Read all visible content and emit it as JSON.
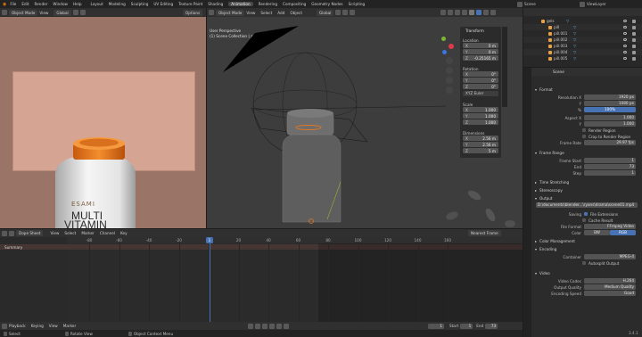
{
  "topbar": {
    "menus": [
      "File",
      "Edit",
      "Render",
      "Window",
      "Help"
    ],
    "tabs": [
      "Layout",
      "Modeling",
      "Sculpting",
      "UV Editing",
      "Texture Paint",
      "Shading",
      "Animation",
      "Rendering",
      "Compositing",
      "Geometry Nodes",
      "Scripting"
    ],
    "active_tab": "Animation",
    "scene_label": "Scene",
    "viewlayer_label": "ViewLayer"
  },
  "camera_view": {
    "mode": "Object Mode",
    "view_label": "View",
    "layer_label": "Global",
    "options_label": "Options",
    "product": {
      "brand": "ESAMI",
      "line1": "MULTI",
      "line2": "VITAMIN"
    }
  },
  "viewport": {
    "mode": "Object Mode",
    "menus": [
      "View",
      "Select",
      "Add",
      "Object"
    ],
    "transform_orientation": "Global",
    "options_label": "Options",
    "overlay_line1": "User Perspective",
    "overlay_line2": "(1) Scene Collection | ambar"
  },
  "n_panel": {
    "title": "Transform",
    "location_label": "Location",
    "location": [
      {
        "axis": "X",
        "value": "0 m"
      },
      {
        "axis": "Y",
        "value": "0 m"
      },
      {
        "axis": "Z",
        "value": "-0.25165 m"
      }
    ],
    "rotation_label": "Rotation",
    "rotation": [
      {
        "axis": "X",
        "value": "0°"
      },
      {
        "axis": "Y",
        "value": "0°"
      },
      {
        "axis": "Z",
        "value": "0°"
      }
    ],
    "rotation_mode": "XYZ Euler",
    "scale_label": "Scale",
    "scale": [
      {
        "axis": "X",
        "value": "1.000"
      },
      {
        "axis": "Y",
        "value": "1.000"
      },
      {
        "axis": "Z",
        "value": "1.000"
      }
    ],
    "dimensions_label": "Dimensions",
    "dimensions": [
      {
        "axis": "X",
        "value": "2.56 m"
      },
      {
        "axis": "Y",
        "value": "2.56 m"
      },
      {
        "axis": "Z",
        "value": "5 m"
      }
    ]
  },
  "outliner": {
    "items": [
      {
        "name": "gels",
        "indent": 0
      },
      {
        "name": "pill",
        "indent": 1
      },
      {
        "name": "pill.001",
        "indent": 1
      },
      {
        "name": "pill.002",
        "indent": 1
      },
      {
        "name": "pill.003",
        "indent": 1
      },
      {
        "name": "pill.004",
        "indent": 1
      },
      {
        "name": "pill.005",
        "indent": 1
      }
    ]
  },
  "properties": {
    "header": "Scene",
    "format_label": "Format",
    "resolution_x_label": "Resolution X",
    "resolution_x": "1920 px",
    "resolution_y_label": "Y",
    "resolution_y": "1080 px",
    "percent_label": "%",
    "percent": "100%",
    "aspect_x_label": "Aspect X",
    "aspect_x": "1.000",
    "aspect_y_label": "Y",
    "aspect_y": "1.000",
    "render_region": "Render Region",
    "crop_region": "Crop to Render Region",
    "frame_rate_label": "Frame Rate",
    "frame_rate": "29.97 fps",
    "frame_range_label": "Frame Range",
    "frame_start_label": "Frame Start",
    "frame_start": "1",
    "frame_end_label": "End",
    "frame_end": "73",
    "step_label": "Step",
    "step": "1",
    "time_stretching": "Time Stretching",
    "stereoscopy": "Stereoscopy",
    "output_label": "Output",
    "output_path": "D:\\documents\\blender...\\ryans\\drama\\scene01.mp4",
    "saving_label": "Saving",
    "file_extensions": "File Extensions",
    "cache_result": "Cache Result",
    "file_format_label": "File Format",
    "file_format": "FFmpeg Video",
    "color_label": "Color",
    "color_bw": "BW",
    "color_rgb": "RGB",
    "color_management": "Color Management",
    "encoding_label": "Encoding",
    "container_label": "Container",
    "container": "MPEG-4",
    "autosplit": "Autosplit Output",
    "video_label": "Video",
    "video_codec_label": "Video Codec",
    "video_codec": "H.264",
    "output_quality_label": "Output Quality",
    "output_quality": "Medium Quality",
    "encoding_speed_label": "Encoding Speed",
    "encoding_speed": "Good"
  },
  "dopesheet": {
    "mode": "Dope Sheet",
    "menus": [
      "View",
      "Select",
      "Marker",
      "Channel",
      "Key"
    ],
    "snap": "Nearest Frame",
    "summary_label": "Summary",
    "ruler_ticks": [
      "-80",
      "-60",
      "-40",
      "-20",
      "0",
      "20",
      "40",
      "60",
      "80",
      "100",
      "120",
      "140",
      "160"
    ],
    "current_frame": "1"
  },
  "timeline": {
    "menus": [
      "Playback",
      "Keying",
      "View",
      "Marker"
    ],
    "start_label": "Start",
    "start": "1",
    "end_label": "End",
    "end": "73",
    "current": "1"
  },
  "statusbar": {
    "select": "Select",
    "rotate": "Rotate View",
    "context": "Object Context Menu",
    "version": "3.4.1"
  },
  "colors": {
    "accent": "#4772b3",
    "playhead": "#4772b3",
    "orange": "#e8761c"
  }
}
